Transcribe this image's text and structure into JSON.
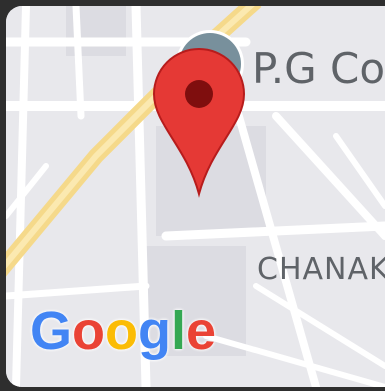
{
  "map": {
    "poi_label": "P.G Col",
    "area_label": "CHANAK",
    "marker": "location-pin-icon",
    "poi_icon": "place-circle-icon"
  },
  "logo": {
    "letters": [
      {
        "char": "G",
        "color": "#4285F4"
      },
      {
        "char": "o",
        "color": "#EA4335"
      },
      {
        "char": "o",
        "color": "#FBBC05"
      },
      {
        "char": "g",
        "color": "#4285F4"
      },
      {
        "char": "l",
        "color": "#34A853"
      },
      {
        "char": "e",
        "color": "#EA4335"
      }
    ]
  },
  "colors": {
    "background": "#e8e8ec",
    "roads": "#ffffff",
    "highway": "#f5d98a",
    "marker": "#e53935",
    "marker_dot": "#7f0e0e",
    "poi_circle": "#78909c"
  }
}
